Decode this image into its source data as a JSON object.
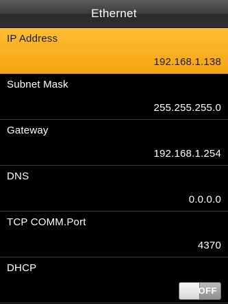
{
  "header": {
    "title": "Ethernet"
  },
  "settings": [
    {
      "label": "IP Address",
      "value": "192.168.1.138",
      "selected": true
    },
    {
      "label": "Subnet Mask",
      "value": "255.255.255.0",
      "selected": false
    },
    {
      "label": "Gateway",
      "value": "192.168.1.254",
      "selected": false
    },
    {
      "label": "DNS",
      "value": "0.0.0.0",
      "selected": false
    },
    {
      "label": "TCP COMM.Port",
      "value": "4370",
      "selected": false
    }
  ],
  "dhcp": {
    "label": "DHCP",
    "toggle_label": "OFF",
    "state": "off"
  },
  "colors": {
    "selected_row": "#f6a918",
    "background": "#000000",
    "text": "#ffffff"
  }
}
